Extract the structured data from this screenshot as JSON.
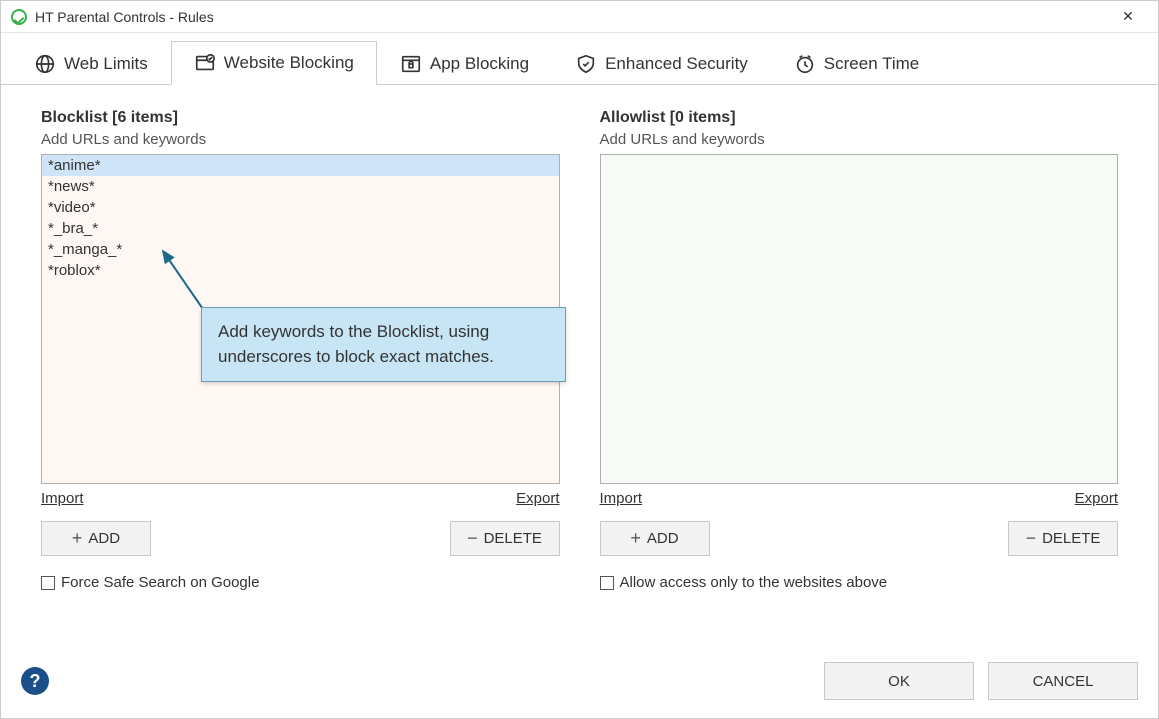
{
  "window": {
    "title": "HT Parental Controls - Rules",
    "close": "✕"
  },
  "tabs": {
    "web_limits": "Web Limits",
    "website_blocking": "Website Blocking",
    "app_blocking": "App Blocking",
    "enhanced_security": "Enhanced Security",
    "screen_time": "Screen Time"
  },
  "blocklist": {
    "header": "Blocklist [6 items]",
    "sub": "Add URLs and keywords",
    "items": [
      "*anime*",
      "*news*",
      "*video*",
      "*_bra_*",
      "*_manga_*",
      "*roblox*"
    ],
    "import": "Import",
    "export": "Export",
    "add": "ADD",
    "delete": "DELETE",
    "checkbox": "Force Safe Search on Google"
  },
  "allowlist": {
    "header": "Allowlist [0 items]",
    "sub": "Add URLs and keywords",
    "items": [],
    "import": "Import",
    "export": "Export",
    "add": "ADD",
    "delete": "DELETE",
    "checkbox": "Allow access only to the websites above"
  },
  "callout": {
    "text": "Add keywords to the Blocklist, using underscores to block exact matches."
  },
  "footer": {
    "help": "?",
    "ok": "OK",
    "cancel": "CANCEL"
  }
}
